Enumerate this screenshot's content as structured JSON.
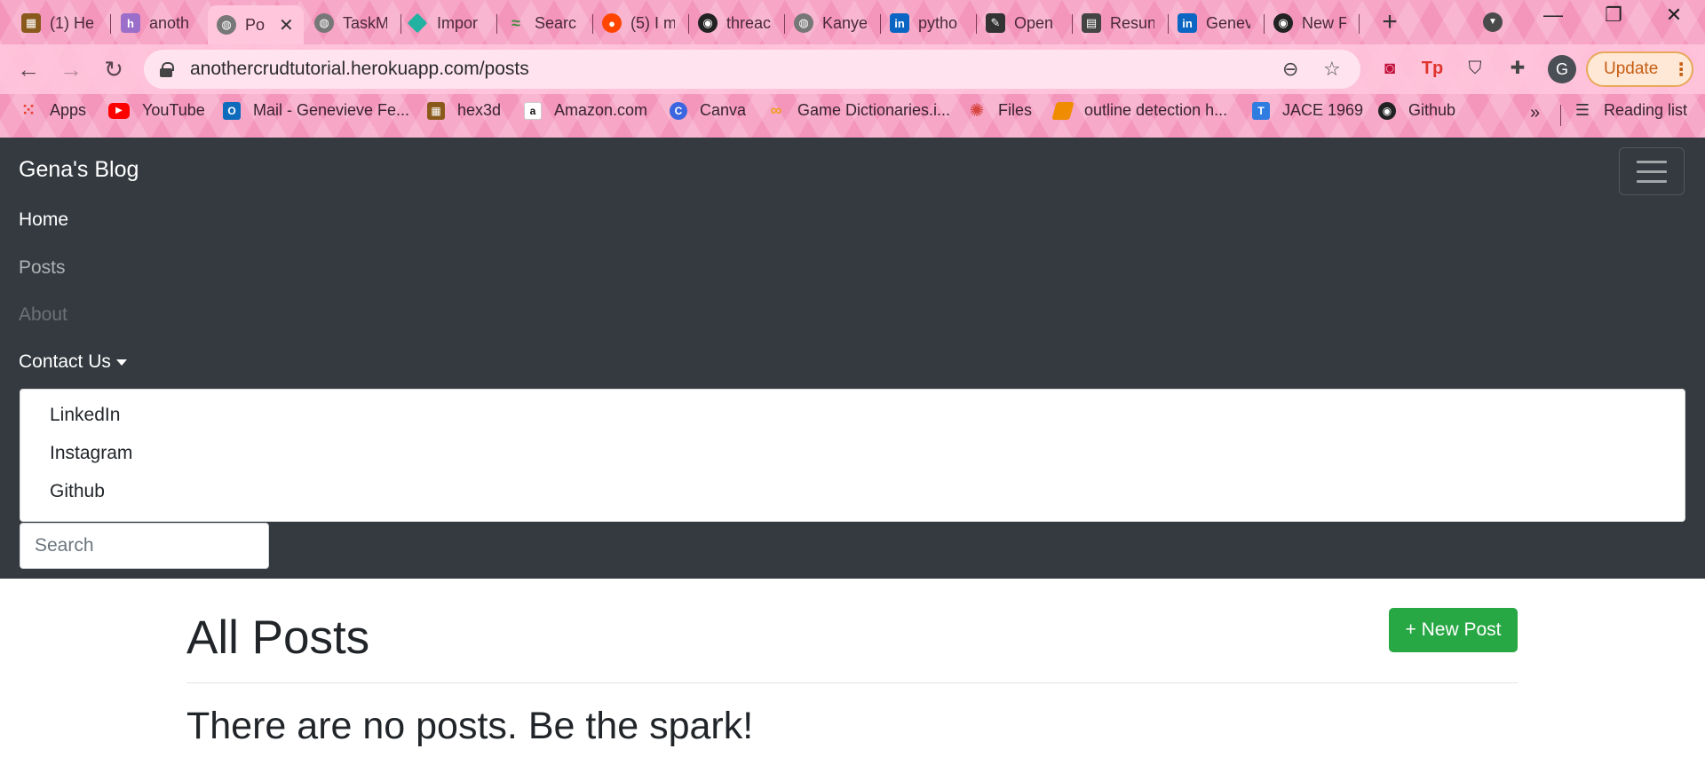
{
  "browser": {
    "tabs": [
      {
        "label": "(1) He",
        "icon": "game-icon",
        "color": "#8a5a1c"
      },
      {
        "label": "anoth",
        "icon": "heroku-icon",
        "color": "#9b6fc9"
      },
      {
        "label": "Po",
        "icon": "globe-icon",
        "color": "#6a6a6a",
        "active": true
      },
      {
        "label": "TaskM",
        "icon": "globe-icon",
        "color": "#6a6a6a"
      },
      {
        "label": "Impor",
        "icon": "diamond-icon",
        "color": "#21b2a1"
      },
      {
        "label": "Searc",
        "icon": "search-engine-icon",
        "color": "#3d8b3d"
      },
      {
        "label": "(5) I m",
        "icon": "reddit-icon",
        "color": "#ff4500"
      },
      {
        "label": "threac",
        "icon": "github-icon",
        "color": "#222222"
      },
      {
        "label": "Kanye",
        "icon": "globe-icon",
        "color": "#6a6a6a"
      },
      {
        "label": "pytho",
        "icon": "linkedin-icon",
        "color": "#0a66c2"
      },
      {
        "label": "Open",
        "icon": "pen-icon",
        "color": "#333333"
      },
      {
        "label": "Resun",
        "icon": "document-icon",
        "color": "#444444"
      },
      {
        "label": "Genev",
        "icon": "linkedin-icon",
        "color": "#0a66c2"
      },
      {
        "label": "New F",
        "icon": "github-icon",
        "color": "#222222"
      }
    ],
    "new_tab": "+",
    "tab_close": "✕",
    "window_controls": {
      "minimize": "—",
      "restore": "❐",
      "close": "✕"
    },
    "url": "anothercrudtutorial.herokuapp.com/posts",
    "update_label": "Update",
    "profile_initial": "G",
    "bookmarks": [
      {
        "label": "Apps",
        "icon": "apps-grid-icon",
        "color": "#e94235"
      },
      {
        "label": "YouTube",
        "icon": "youtube-icon",
        "color": "#ff0000"
      },
      {
        "label": "Mail - Genevieve Fe...",
        "icon": "outlook-icon",
        "color": "#0f6cbd"
      },
      {
        "label": "hex3d",
        "icon": "game-icon",
        "color": "#8a5a1c"
      },
      {
        "label": "Amazon.com",
        "icon": "amazon-icon",
        "color": "#111111"
      },
      {
        "label": "Canva",
        "icon": "canva-icon",
        "color": "#3b66e0"
      },
      {
        "label": "Game Dictionaries.i...",
        "icon": "infinity-icon",
        "color": "#f29d1a"
      },
      {
        "label": "Files",
        "icon": "files-icon",
        "color": "#d6453e"
      },
      {
        "label": "outline detection h...",
        "icon": "bookmark-icon",
        "color": "#f08c00"
      },
      {
        "label": "JACE 1969",
        "icon": "jace-icon",
        "color": "#2f7de1"
      },
      {
        "label": "Github",
        "icon": "github-icon",
        "color": "#222222"
      }
    ],
    "bookmarks_more": "»",
    "reading_list_label": "Reading list"
  },
  "site": {
    "brand": "Gena's Blog",
    "nav": {
      "home": "Home",
      "posts": "Posts",
      "about": "About",
      "contact": "Contact Us"
    },
    "dropdown_items": [
      "LinkedIn",
      "Instagram",
      "Github"
    ],
    "search_placeholder": "Search"
  },
  "main": {
    "title": "All Posts",
    "new_post_label": "+ New Post",
    "empty_message": "There are no posts. Be the spark!"
  },
  "colors": {
    "navbar_bg": "#343a40",
    "success": "#28a745",
    "chrome_pink": "#f7a6c6"
  }
}
